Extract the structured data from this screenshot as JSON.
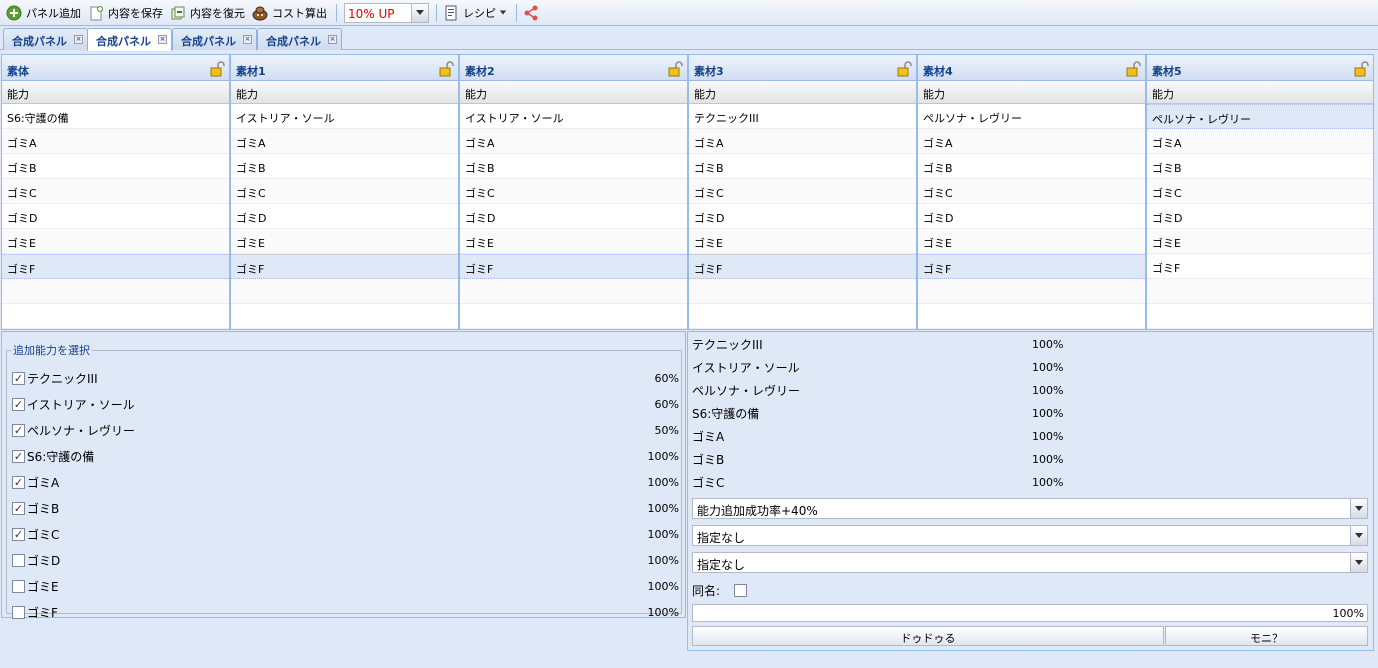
{
  "toolbar": {
    "add_panel": "パネル追加",
    "save": "内容を保存",
    "restore": "内容を復元",
    "cost": "コスト算出",
    "up_value": "10% UP",
    "recipe": "レシピ"
  },
  "tabs": [
    {
      "label": "合成パネル"
    },
    {
      "label": "合成パネル"
    },
    {
      "label": "合成パネル"
    },
    {
      "label": "合成パネル"
    }
  ],
  "columns": [
    {
      "title": "素体",
      "sub": "能力",
      "rows": [
        "S6:守護の備",
        "ゴミA",
        "ゴミB",
        "ゴミC",
        "ゴミD",
        "ゴミE",
        "ゴミF"
      ]
    },
    {
      "title": "素材1",
      "sub": "能力",
      "rows": [
        "イストリア・ソール",
        "ゴミA",
        "ゴミB",
        "ゴミC",
        "ゴミD",
        "ゴミE",
        "ゴミF"
      ]
    },
    {
      "title": "素材2",
      "sub": "能力",
      "rows": [
        "イストリア・ソール",
        "ゴミA",
        "ゴミB",
        "ゴミC",
        "ゴミD",
        "ゴミE",
        "ゴミF"
      ]
    },
    {
      "title": "素材3",
      "sub": "能力",
      "rows": [
        "テクニックIII",
        "ゴミA",
        "ゴミB",
        "ゴミC",
        "ゴミD",
        "ゴミE",
        "ゴミF"
      ]
    },
    {
      "title": "素材4",
      "sub": "能力",
      "rows": [
        "ペルソナ・レヴリー",
        "ゴミA",
        "ゴミB",
        "ゴミC",
        "ゴミD",
        "ゴミE",
        "ゴミF"
      ]
    },
    {
      "title": "素材5",
      "sub": "能力",
      "rows": [
        "ペルソナ・レヴリー",
        "ゴミA",
        "ゴミB",
        "ゴミC",
        "ゴミD",
        "ゴミE",
        "ゴミF"
      ]
    }
  ],
  "select_panel": {
    "legend": "追加能力を選択",
    "items": [
      {
        "label": "テクニックIII",
        "pct": "60%",
        "checked": true
      },
      {
        "label": "イストリア・ソール",
        "pct": "60%",
        "checked": true
      },
      {
        "label": "ペルソナ・レヴリー",
        "pct": "50%",
        "checked": true
      },
      {
        "label": "S6:守護の備",
        "pct": "100%",
        "checked": true
      },
      {
        "label": "ゴミA",
        "pct": "100%",
        "checked": true
      },
      {
        "label": "ゴミB",
        "pct": "100%",
        "checked": true
      },
      {
        "label": "ゴミC",
        "pct": "100%",
        "checked": true
      },
      {
        "label": "ゴミD",
        "pct": "100%",
        "checked": false
      },
      {
        "label": "ゴミE",
        "pct": "100%",
        "checked": false
      },
      {
        "label": "ゴミF",
        "pct": "100%",
        "checked": false
      }
    ]
  },
  "result": {
    "abilities": [
      {
        "label": "テクニックIII",
        "pct": "100%"
      },
      {
        "label": "イストリア・ソール",
        "pct": "100%"
      },
      {
        "label": "ペルソナ・レヴリー",
        "pct": "100%"
      },
      {
        "label": "S6:守護の備",
        "pct": "100%"
      },
      {
        "label": "ゴミA",
        "pct": "100%"
      },
      {
        "label": "ゴミB",
        "pct": "100%"
      },
      {
        "label": "ゴミC",
        "pct": "100%"
      }
    ],
    "selects": [
      "能力追加成功率+40%",
      "指定なし",
      "指定なし"
    ],
    "same_name_label": "同名:",
    "progress_text": "100%",
    "progress_value": 100,
    "btn_left": "ドゥドゥる",
    "btn_right": "モニ？"
  },
  "colors": {
    "accent": "#15428b",
    "up_text": "#e00000",
    "share": "#e05050"
  }
}
